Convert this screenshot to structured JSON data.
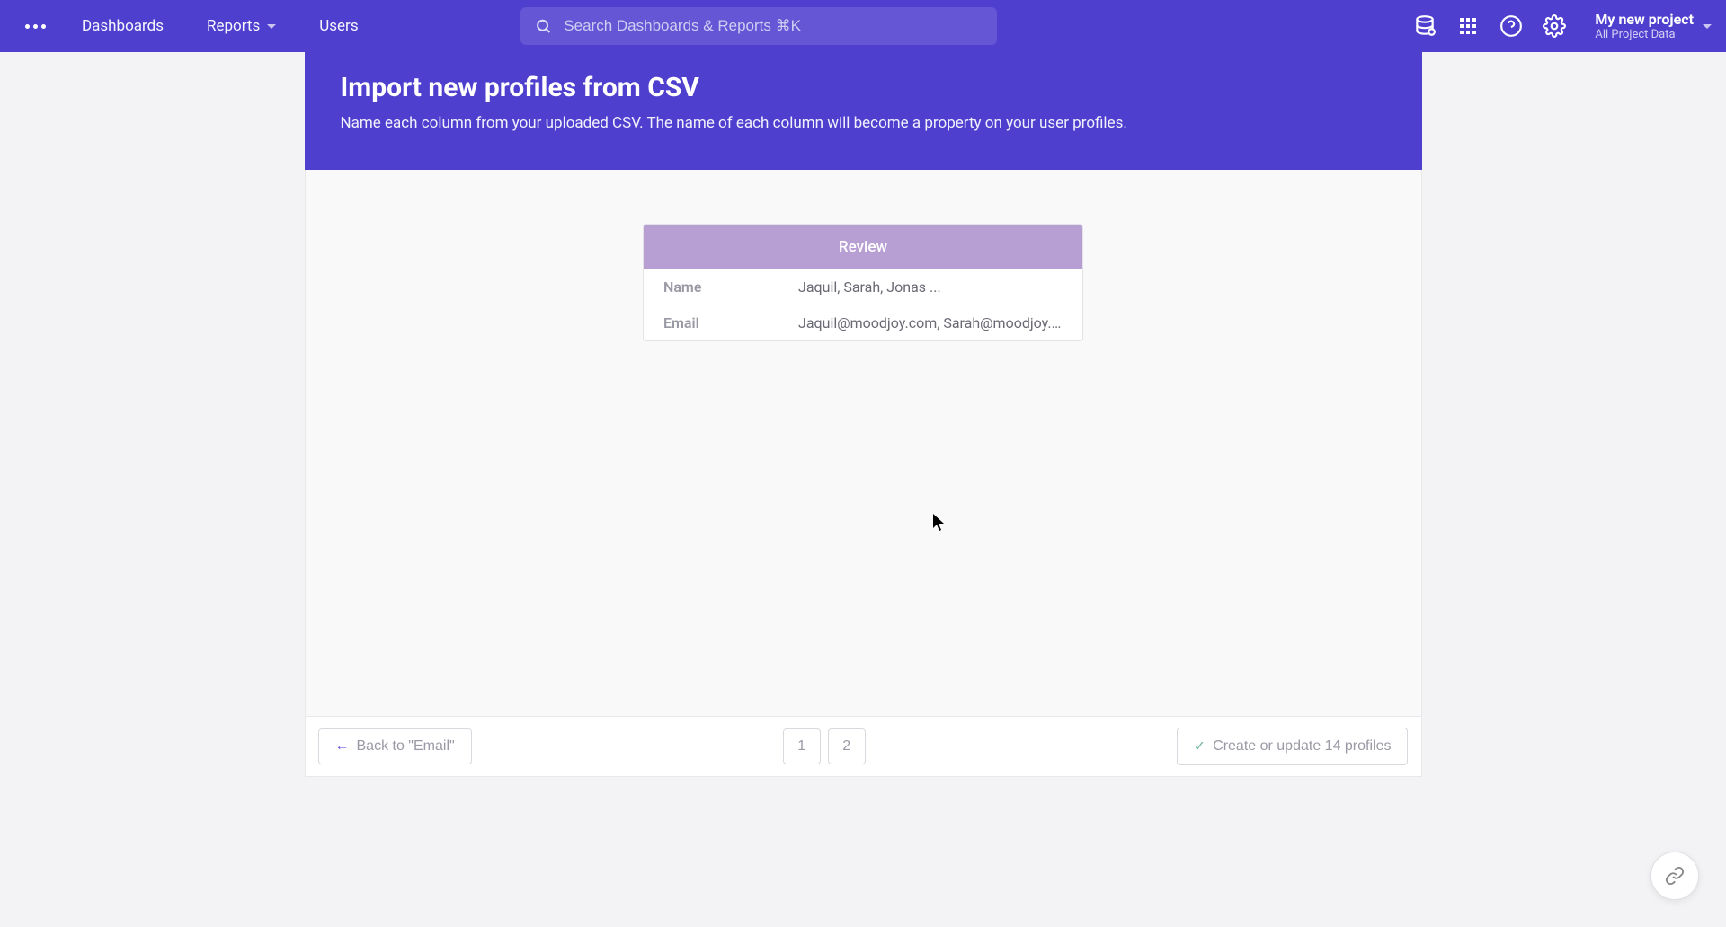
{
  "nav": {
    "dashboards": "Dashboards",
    "reports": "Reports",
    "users": "Users"
  },
  "search": {
    "placeholder": "Search Dashboards & Reports ⌘K"
  },
  "project": {
    "name": "My new project",
    "subtitle": "All Project Data"
  },
  "header": {
    "title": "Import new profiles from CSV",
    "description": "Name each column from your uploaded CSV. The name of each column will become a property on your user profiles."
  },
  "review": {
    "header": "Review",
    "rows": [
      {
        "label": "Name",
        "value": "Jaquil, Sarah, Jonas ..."
      },
      {
        "label": "Email",
        "value": "Jaquil@moodjoy.com, Sarah@moodjoy.c..."
      }
    ]
  },
  "footer": {
    "back": "Back to \"Email\"",
    "pages": [
      "1",
      "2"
    ],
    "submit": "Create or update 14 profiles"
  }
}
